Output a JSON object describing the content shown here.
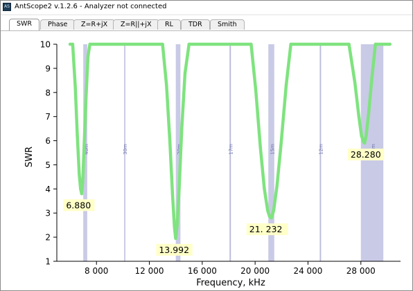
{
  "window": {
    "icon_text": "AS",
    "title": "AntScope2 v.1.2.6 - Analyzer not connected"
  },
  "tabs": [
    {
      "label": "SWR",
      "active": true
    },
    {
      "label": "Phase",
      "active": false
    },
    {
      "label": "Z=R+jX",
      "active": false
    },
    {
      "label": "Z=R||+jX",
      "active": false
    },
    {
      "label": "RL",
      "active": false
    },
    {
      "label": "TDR",
      "active": false
    },
    {
      "label": "Smith",
      "active": false
    }
  ],
  "colors": {
    "curve": "#7fe37f",
    "band_fill": "#c9cae6",
    "band_line": "#b9bbdc",
    "band_label": "#6a6fa8",
    "marker_bg": "#ffffc8"
  },
  "chart_data": {
    "type": "line",
    "xlabel": "Frequency, kHz",
    "ylabel": "SWR",
    "xlim": [
      5000,
      31000
    ],
    "ylim": [
      1,
      10
    ],
    "x_ticks": [
      8000,
      12000,
      16000,
      20000,
      24000,
      28000
    ],
    "x_tick_labels": [
      "8 000",
      "12 000",
      "16 000",
      "20 000",
      "24 000",
      "28 000"
    ],
    "y_ticks": [
      1,
      2,
      3,
      4,
      5,
      6,
      7,
      8,
      9,
      10
    ],
    "y_tick_labels": [
      "1",
      "2",
      "3",
      "4",
      "5",
      "6",
      "7",
      "8",
      "9",
      "10"
    ],
    "grid": false,
    "bands": [
      {
        "label": "40m",
        "start": 7000,
        "end": 7300
      },
      {
        "label": "30m",
        "start": 10100,
        "end": 10150
      },
      {
        "label": "20m",
        "start": 14000,
        "end": 14350
      },
      {
        "label": "17m",
        "start": 18068,
        "end": 18168
      },
      {
        "label": "15m",
        "start": 21000,
        "end": 21450
      },
      {
        "label": "12m",
        "start": 24890,
        "end": 24990
      },
      {
        "label": "10m",
        "start": 28000,
        "end": 29700
      }
    ],
    "series": [
      {
        "x": [
          6000,
          6200,
          6400,
          6550,
          6700,
          6800,
          6880,
          6960,
          7060,
          7200,
          7360,
          7500,
          13000,
          13300,
          13550,
          13750,
          13900,
          13992,
          14100,
          14250,
          14450,
          14700,
          15000,
          19700,
          20050,
          20400,
          20700,
          20950,
          21100,
          21232,
          21400,
          21650,
          21950,
          22350,
          22700,
          27100,
          27550,
          27850,
          28050,
          28200,
          28280,
          28400,
          28600,
          28850,
          29100,
          30200
        ],
        "y": [
          10,
          10,
          8.2,
          6.2,
          4.6,
          4.0,
          3.8,
          4.3,
          5.7,
          7.7,
          9.5,
          10,
          10,
          8.3,
          6.0,
          3.8,
          2.4,
          1.95,
          2.5,
          4.0,
          6.5,
          8.8,
          10,
          10,
          8.1,
          5.7,
          4.0,
          3.1,
          2.85,
          2.8,
          3.1,
          4.1,
          5.8,
          8.3,
          10,
          10,
          8.4,
          7.0,
          6.2,
          5.95,
          5.9,
          6.2,
          7.2,
          8.7,
          10,
          10
        ]
      }
    ],
    "markers": [
      {
        "label": "6.880",
        "x": 6880,
        "y": 3.8
      },
      {
        "label": "13.992",
        "x": 13992,
        "y": 1.95
      },
      {
        "label": "21. 232",
        "x": 21232,
        "y": 2.8
      },
      {
        "label": "28.280",
        "x": 28280,
        "y": 5.9
      }
    ]
  }
}
